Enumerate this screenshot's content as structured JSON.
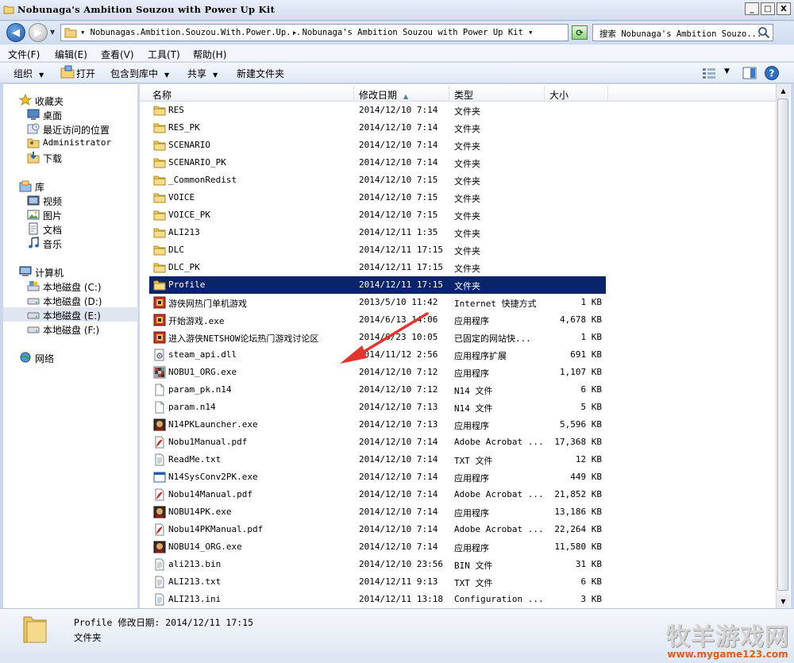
{
  "window": {
    "title": "Nobunaga's Ambition Souzou with Power Up Kit",
    "minimize_glyph": "_",
    "maximize_glyph": "□",
    "close_glyph": "X"
  },
  "address": {
    "crumb1": "▾ Nobunagas.Ambition.Souzou.With.Power.Up...",
    "crumb2": "▸ Nobunaga's Ambition Souzou with Power Up Kit ▾",
    "search_placeholder": "搜索 Nobunaga's Ambition Souzo..."
  },
  "menu": {
    "file": "文件(F)",
    "edit": "编辑(E)",
    "view": "查看(V)",
    "tools": "工具(T)",
    "help": "帮助(H)"
  },
  "toolbar": {
    "organize": "组织",
    "open": "打开",
    "include_library": "包含到库中",
    "share": "共享",
    "new_folder": "新建文件夹"
  },
  "nav": {
    "favorites": "收藏夹",
    "desktop": "桌面",
    "recent": "最近访问的位置",
    "administrator": "Administrator",
    "downloads": "下载",
    "library": "库",
    "videos": "视频",
    "pictures": "图片",
    "documents": "文档",
    "music": "音乐",
    "computer": "计算机",
    "disk_c": "本地磁盘 (C:)",
    "disk_d": "本地磁盘 (D:)",
    "disk_e": "本地磁盘 (E:)",
    "disk_f": "本地磁盘 (F:)",
    "network": "网络"
  },
  "columns": {
    "name": "名称",
    "modified": "修改日期",
    "type": "类型",
    "size": "大小"
  },
  "files": [
    {
      "name": "RES",
      "date": "2014/12/10 7:14",
      "type": "文件夹",
      "size": "",
      "icon": "folder"
    },
    {
      "name": "RES_PK",
      "date": "2014/12/10 7:14",
      "type": "文件夹",
      "size": "",
      "icon": "folder"
    },
    {
      "name": "SCENARIO",
      "date": "2014/12/10 7:14",
      "type": "文件夹",
      "size": "",
      "icon": "folder"
    },
    {
      "name": "SCENARIO_PK",
      "date": "2014/12/10 7:14",
      "type": "文件夹",
      "size": "",
      "icon": "folder"
    },
    {
      "name": "_CommonRedist",
      "date": "2014/12/10 7:15",
      "type": "文件夹",
      "size": "",
      "icon": "folder"
    },
    {
      "name": "VOICE",
      "date": "2014/12/10 7:15",
      "type": "文件夹",
      "size": "",
      "icon": "folder"
    },
    {
      "name": "VOICE_PK",
      "date": "2014/12/10 7:15",
      "type": "文件夹",
      "size": "",
      "icon": "folder"
    },
    {
      "name": "ALI213",
      "date": "2014/12/11 1:35",
      "type": "文件夹",
      "size": "",
      "icon": "folder"
    },
    {
      "name": "DLC",
      "date": "2014/12/11 17:15",
      "type": "文件夹",
      "size": "",
      "icon": "folder"
    },
    {
      "name": "DLC_PK",
      "date": "2014/12/11 17:15",
      "type": "文件夹",
      "size": "",
      "icon": "folder"
    },
    {
      "name": "Profile",
      "date": "2014/12/11 17:15",
      "type": "文件夹",
      "size": "",
      "icon": "folder",
      "selected": true
    },
    {
      "name": "游侠网热门单机游戏",
      "date": "2013/5/10 11:42",
      "type": "Internet 快捷方式",
      "size": "1 KB",
      "icon": "game-exe"
    },
    {
      "name": "开始游戏.exe",
      "date": "2014/6/13 14:06",
      "type": "应用程序",
      "size": "4,678 KB",
      "icon": "game-exe"
    },
    {
      "name": "进入游侠NETSHOW论坛热门游戏讨论区",
      "date": "2014/6/23 10:05",
      "type": "已固定的网站快...",
      "size": "1 KB",
      "icon": "game-exe"
    },
    {
      "name": "steam_api.dll",
      "date": "2014/11/12 2:56",
      "type": "应用程序扩展",
      "size": "691 KB",
      "icon": "dll"
    },
    {
      "name": "NOBU1_ORG.exe",
      "date": "2014/12/10 7:12",
      "type": "应用程序",
      "size": "1,107 KB",
      "icon": "mosaic-exe"
    },
    {
      "name": "param_pk.n14",
      "date": "2014/12/10 7:12",
      "type": "N14 文件",
      "size": "6 KB",
      "icon": "blank"
    },
    {
      "name": "param.n14",
      "date": "2014/12/10 7:13",
      "type": "N14 文件",
      "size": "5 KB",
      "icon": "blank"
    },
    {
      "name": "N14PKLauncher.exe",
      "date": "2014/12/10 7:13",
      "type": "应用程序",
      "size": "5,596 KB",
      "icon": "nobu-exe"
    },
    {
      "name": "Nobu1Manual.pdf",
      "date": "2014/12/10 7:14",
      "type": "Adobe Acrobat ...",
      "size": "17,368 KB",
      "icon": "pdf"
    },
    {
      "name": "ReadMe.txt",
      "date": "2014/12/10 7:14",
      "type": "TXT 文件",
      "size": "12 KB",
      "icon": "txt"
    },
    {
      "name": "N14SysConv2PK.exe",
      "date": "2014/12/10 7:14",
      "type": "应用程序",
      "size": "449 KB",
      "icon": "window-exe"
    },
    {
      "name": "Nobu14Manual.pdf",
      "date": "2014/12/10 7:14",
      "type": "Adobe Acrobat ...",
      "size": "21,852 KB",
      "icon": "pdf"
    },
    {
      "name": "NOBU14PK.exe",
      "date": "2014/12/10 7:14",
      "type": "应用程序",
      "size": "13,186 KB",
      "icon": "nobu-exe"
    },
    {
      "name": "Nobu14PKManual.pdf",
      "date": "2014/12/10 7:14",
      "type": "Adobe Acrobat ...",
      "size": "22,264 KB",
      "icon": "pdf"
    },
    {
      "name": "NOBU14_ORG.exe",
      "date": "2014/12/10 7:14",
      "type": "应用程序",
      "size": "11,580 KB",
      "icon": "nobu-exe"
    },
    {
      "name": "ali213.bin",
      "date": "2014/12/10 23:56",
      "type": "BIN 文件",
      "size": "31 KB",
      "icon": "txt"
    },
    {
      "name": "ALI213.txt",
      "date": "2014/12/11 9:13",
      "type": "TXT 文件",
      "size": "6 KB",
      "icon": "txt"
    },
    {
      "name": "ALI213.ini",
      "date": "2014/12/11 13:18",
      "type": "Configuration ...",
      "size": "3 KB",
      "icon": "txt"
    }
  ],
  "details": {
    "line1": "Profile 修改日期: 2014/12/11 17:15",
    "line2": "文件夹"
  },
  "watermark": {
    "title": "牧羊游戏网",
    "url": "www.mygame123.com"
  },
  "colors": {
    "selection": "#0a246a",
    "annotation_arrow": "#e8322d"
  }
}
